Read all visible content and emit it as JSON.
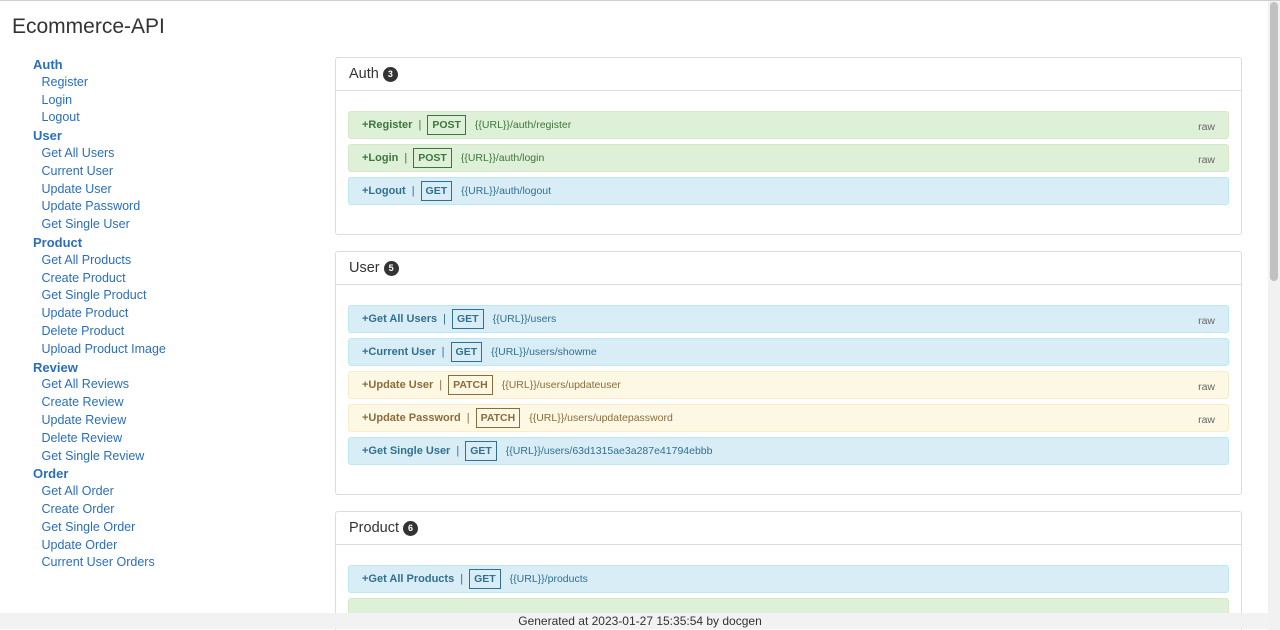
{
  "app_title": "Ecommerce-API",
  "sidebar": {
    "groups": [
      {
        "label": "Auth",
        "items": [
          "Register",
          "Login",
          "Logout"
        ]
      },
      {
        "label": "User",
        "items": [
          "Get All Users",
          "Current User",
          "Update User",
          "Update Password",
          "Get Single User"
        ]
      },
      {
        "label": "Product",
        "items": [
          "Get All Products",
          "Create Product",
          "Get Single Product",
          "Update Product",
          "Delete Product",
          "Upload Product Image"
        ]
      },
      {
        "label": "Review",
        "items": [
          "Get All Reviews",
          "Create Review",
          "Update Review",
          "Delete Review",
          "Get Single Review"
        ]
      },
      {
        "label": "Order",
        "items": [
          "Get All Order",
          "Create Order",
          "Get Single Order",
          "Update Order",
          "Current User Orders"
        ]
      }
    ]
  },
  "sections": [
    {
      "title": "Auth",
      "count": "3",
      "requests": [
        {
          "name": "+Register",
          "method": "POST",
          "url": "{{URL}}/auth/register",
          "raw": "raw",
          "color": "post"
        },
        {
          "name": "+Login",
          "method": "POST",
          "url": "{{URL}}/auth/login",
          "raw": "raw",
          "color": "post"
        },
        {
          "name": "+Logout",
          "method": "GET",
          "url": "{{URL}}/auth/logout",
          "raw": "",
          "color": "get"
        }
      ]
    },
    {
      "title": "User",
      "count": "5",
      "requests": [
        {
          "name": "+Get All Users",
          "method": "GET",
          "url": "{{URL}}/users",
          "raw": "raw",
          "color": "get"
        },
        {
          "name": "+Current User",
          "method": "GET",
          "url": "{{URL}}/users/showme",
          "raw": "",
          "color": "get"
        },
        {
          "name": "+Update User",
          "method": "PATCH",
          "url": "{{URL}}/users/updateuser",
          "raw": "raw",
          "color": "patch"
        },
        {
          "name": "+Update Password",
          "method": "PATCH",
          "url": "{{URL}}/users/updatepassword",
          "raw": "raw",
          "color": "patch"
        },
        {
          "name": "+Get Single User",
          "method": "GET",
          "url": "{{URL}}/users/63d1315ae3a287e41794ebbb",
          "raw": "",
          "color": "get"
        }
      ]
    },
    {
      "title": "Product",
      "count": "6",
      "requests": [
        {
          "name": "+Get All Products",
          "method": "GET",
          "url": "{{URL}}/products",
          "raw": "",
          "color": "get"
        },
        {
          "name": "",
          "method": "",
          "url": "",
          "raw": "",
          "color": "post"
        }
      ]
    }
  ],
  "footer": "Generated at 2023-01-27 15:35:54 by docgen",
  "colors": {
    "link": "#2a6ebb",
    "post_bg": "#dff0d8",
    "get_bg": "#d9edf7",
    "patch_bg": "#fcf8e3"
  }
}
